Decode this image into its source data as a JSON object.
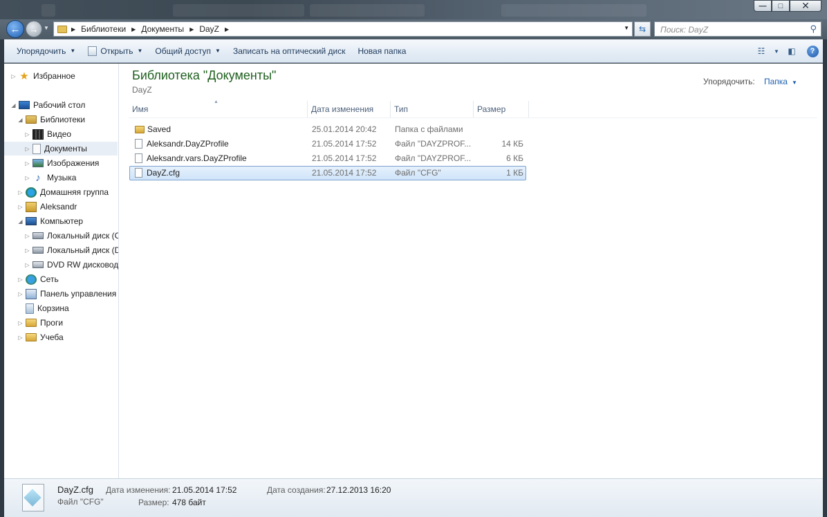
{
  "window": {
    "minimize_glyph": "—",
    "maximize_glyph": "□",
    "close_glyph": "✕"
  },
  "address": {
    "breadcrumbs": [
      "Библиотеки",
      "Документы",
      "DayZ"
    ],
    "search_placeholder": "Поиск: DayZ"
  },
  "toolbar": {
    "organize": "Упорядочить",
    "open": "Открыть",
    "share": "Общий доступ",
    "burn": "Записать на оптический диск",
    "new_folder": "Новая папка",
    "help_glyph": "?"
  },
  "nav": {
    "favorites": "Избранное",
    "desktop": "Рабочий стол",
    "libraries": "Библиотеки",
    "video": "Видео",
    "documents": "Документы",
    "images": "Изображения",
    "music": "Музыка",
    "homegroup": "Домашняя группа",
    "user": "Aleksandr",
    "computer": "Компьютер",
    "disk_c": "Локальный диск (C:)",
    "disk_d": "Локальный диск (D:)",
    "dvd": "DVD RW дисковод (E:)",
    "network": "Сеть",
    "control_panel": "Панель управления",
    "recycle_bin": "Корзина",
    "progi": "Проги",
    "ucheba": "Учеба"
  },
  "content": {
    "library_title": "Библиотека \"Документы\"",
    "library_subtitle": "DayZ",
    "arrange_label": "Упорядочить:",
    "arrange_value": "Папка",
    "columns": {
      "name": "Имя",
      "date": "Дата изменения",
      "type": "Тип",
      "size": "Размер"
    },
    "rows": [
      {
        "name": "Saved",
        "date": "25.01.2014 20:42",
        "type": "Папка с файлами",
        "size": ""
      },
      {
        "name": "Aleksandr.DayZProfile",
        "date": "21.05.2014 17:52",
        "type": "Файл \"DAYZPROF...",
        "size": "14 КБ"
      },
      {
        "name": "Aleksandr.vars.DayZProfile",
        "date": "21.05.2014 17:52",
        "type": "Файл \"DAYZPROF...",
        "size": "6 КБ"
      },
      {
        "name": "DayZ.cfg",
        "date": "21.05.2014 17:52",
        "type": "Файл \"CFG\"",
        "size": "1 КБ"
      }
    ]
  },
  "details": {
    "name": "DayZ.cfg",
    "type": "Файл \"CFG\"",
    "modified_label": "Дата изменения:",
    "modified_value": "21.05.2014 17:52",
    "created_label": "Дата создания:",
    "created_value": "27.12.2013 16:20",
    "size_label": "Размер:",
    "size_value": "478 байт"
  }
}
